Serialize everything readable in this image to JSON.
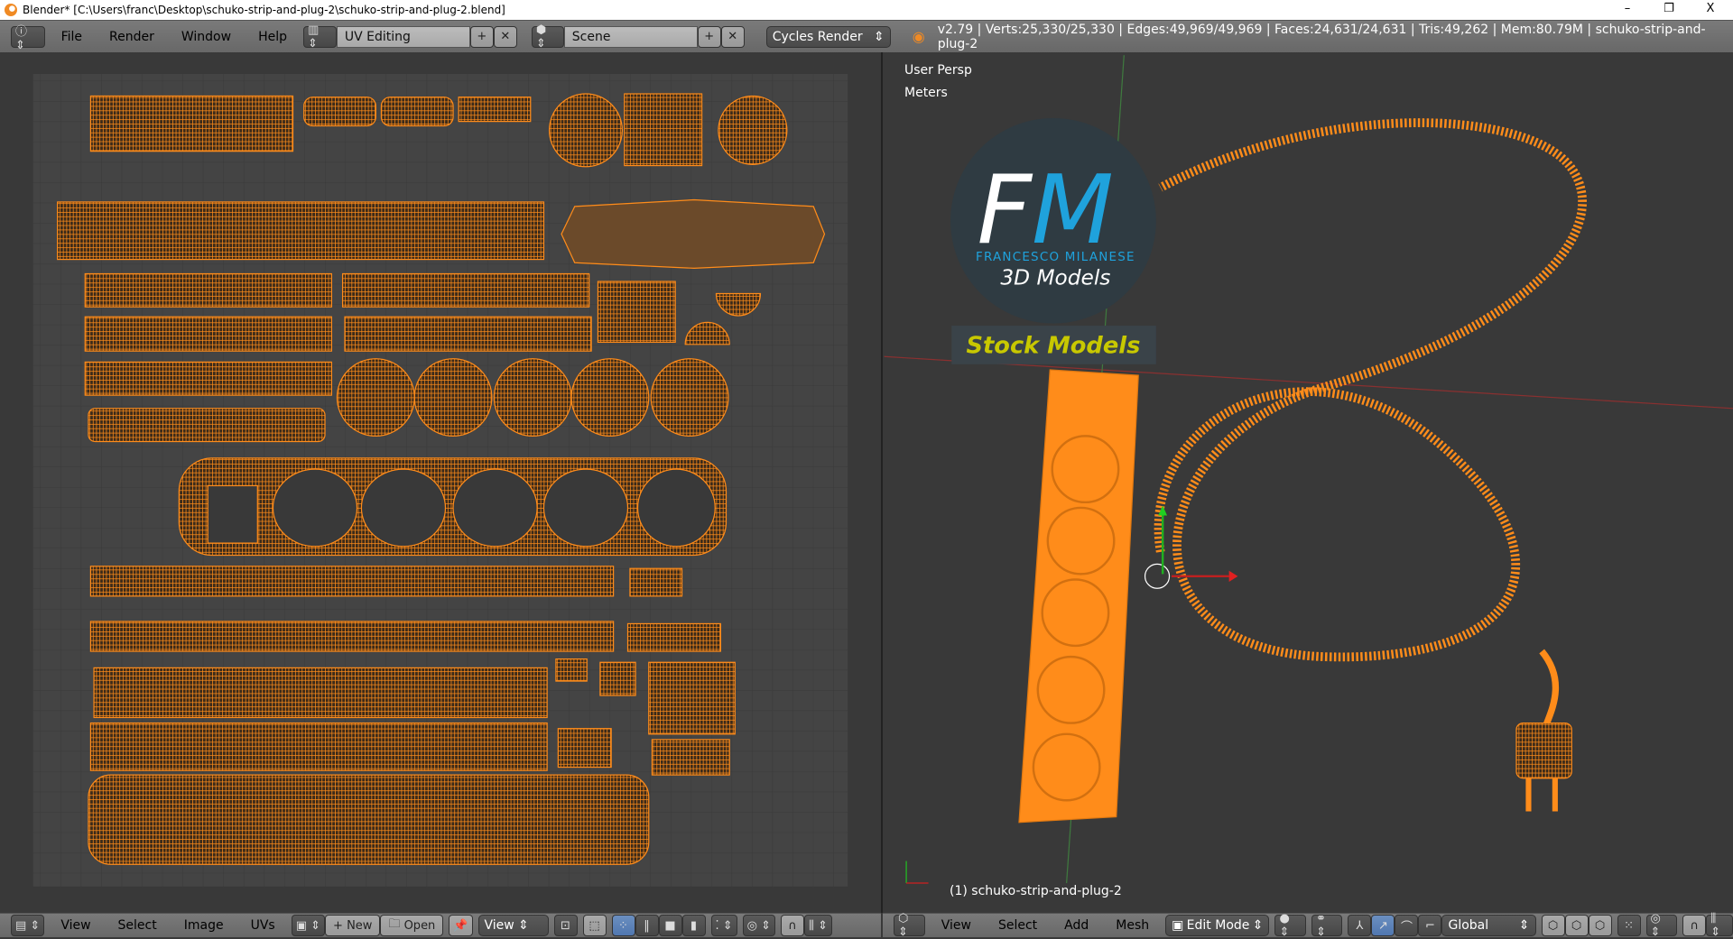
{
  "window": {
    "title": "Blender* [C:\\Users\\franc\\Desktop\\schuko-strip-and-plug-2\\schuko-strip-and-plug-2.blend]",
    "minimize": "–",
    "maximize": "❐",
    "close": "X"
  },
  "topbar": {
    "menus": [
      "File",
      "Render",
      "Window",
      "Help"
    ],
    "screen_layout": "UV Editing",
    "scene": "Scene",
    "render_engine": "Cycles Render",
    "stats": "v2.79 | Verts:25,330/25,330 | Edges:49,969/49,969 | Faces:24,631/24,631 | Tris:49,262 | Mem:80.79M | schuko-strip-and-plug-2"
  },
  "viewport": {
    "view_name": "User Persp",
    "units": "Meters",
    "object_label": "(1) schuko-strip-and-plug-2"
  },
  "logo": {
    "initials": "FM",
    "name": "FRANCESCO MILANESE",
    "tagline": "3D Models",
    "banner": "Stock Models"
  },
  "uv_header": {
    "menus": [
      "View",
      "Select",
      "Image",
      "UVs"
    ],
    "new": "New",
    "open": "Open",
    "view": "View"
  },
  "view3d_header": {
    "menus": [
      "View",
      "Select",
      "Add",
      "Mesh"
    ],
    "mode": "Edit Mode",
    "orientation": "Global"
  },
  "colors": {
    "accent": "#ff8c1a",
    "header": "#727272",
    "background": "#393939",
    "logo_blue": "#1fa2dc",
    "banner_text": "#c8c800"
  }
}
